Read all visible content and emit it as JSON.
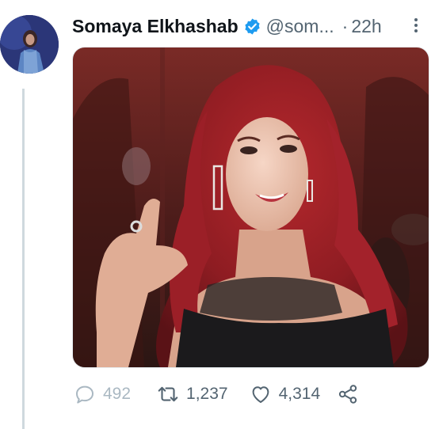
{
  "tweet": {
    "display_name": "Somaya Elkhashab",
    "handle": "@som...",
    "separator": "·",
    "time": "22h"
  },
  "actions": {
    "replies": "492",
    "retweets": "1,237",
    "likes": "4,314"
  },
  "colors": {
    "verified": "#1d9bf0",
    "text": "#0f1419",
    "muted": "#536471",
    "line": "#cfd9de"
  }
}
